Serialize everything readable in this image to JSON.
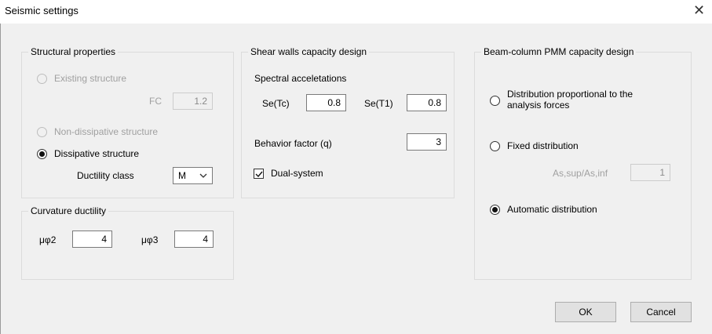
{
  "window": {
    "title": "Seismic settings",
    "close_glyph": "✕"
  },
  "structural_properties": {
    "title": "Structural properties",
    "existing_label": "Existing structure",
    "fc_label": "FC",
    "fc_value": "1.2",
    "non_dissipative_label": "Non-dissipative structure",
    "dissipative_label": "Dissipative structure",
    "ductility_class_label": "Ductility class",
    "ductility_class_value": "M",
    "selected": "dissipative"
  },
  "curvature_ductility": {
    "title": "Curvature ductility",
    "mu2_label": "μφ2",
    "mu2_value": "4",
    "mu3_label": "μφ3",
    "mu3_value": "4"
  },
  "shear_walls": {
    "title": "Shear walls capacity design",
    "spectral_label": "Spectral acceletations",
    "setc_label": "Se(Tc)",
    "setc_value": "0.8",
    "set1_label": "Se(T1)",
    "set1_value": "0.8",
    "behavior_label": "Behavior factor (q)",
    "behavior_value": "3",
    "dual_label": "Dual-system",
    "dual_checked": true
  },
  "beam_column": {
    "title": "Beam-column PMM capacity design",
    "dist_prop_line1": "Distribution proportional to the",
    "dist_prop_line2": "analysis forces",
    "fixed_label": "Fixed distribution",
    "ratio_label": "As,sup/As,inf",
    "ratio_value": "1",
    "auto_label": "Automatic distribution",
    "selected": "automatic"
  },
  "buttons": {
    "ok": "OK",
    "cancel": "Cancel"
  },
  "icons": {
    "close": "close-icon",
    "dropdown": "chevron-down-icon",
    "checkmark": "checkmark-icon"
  }
}
